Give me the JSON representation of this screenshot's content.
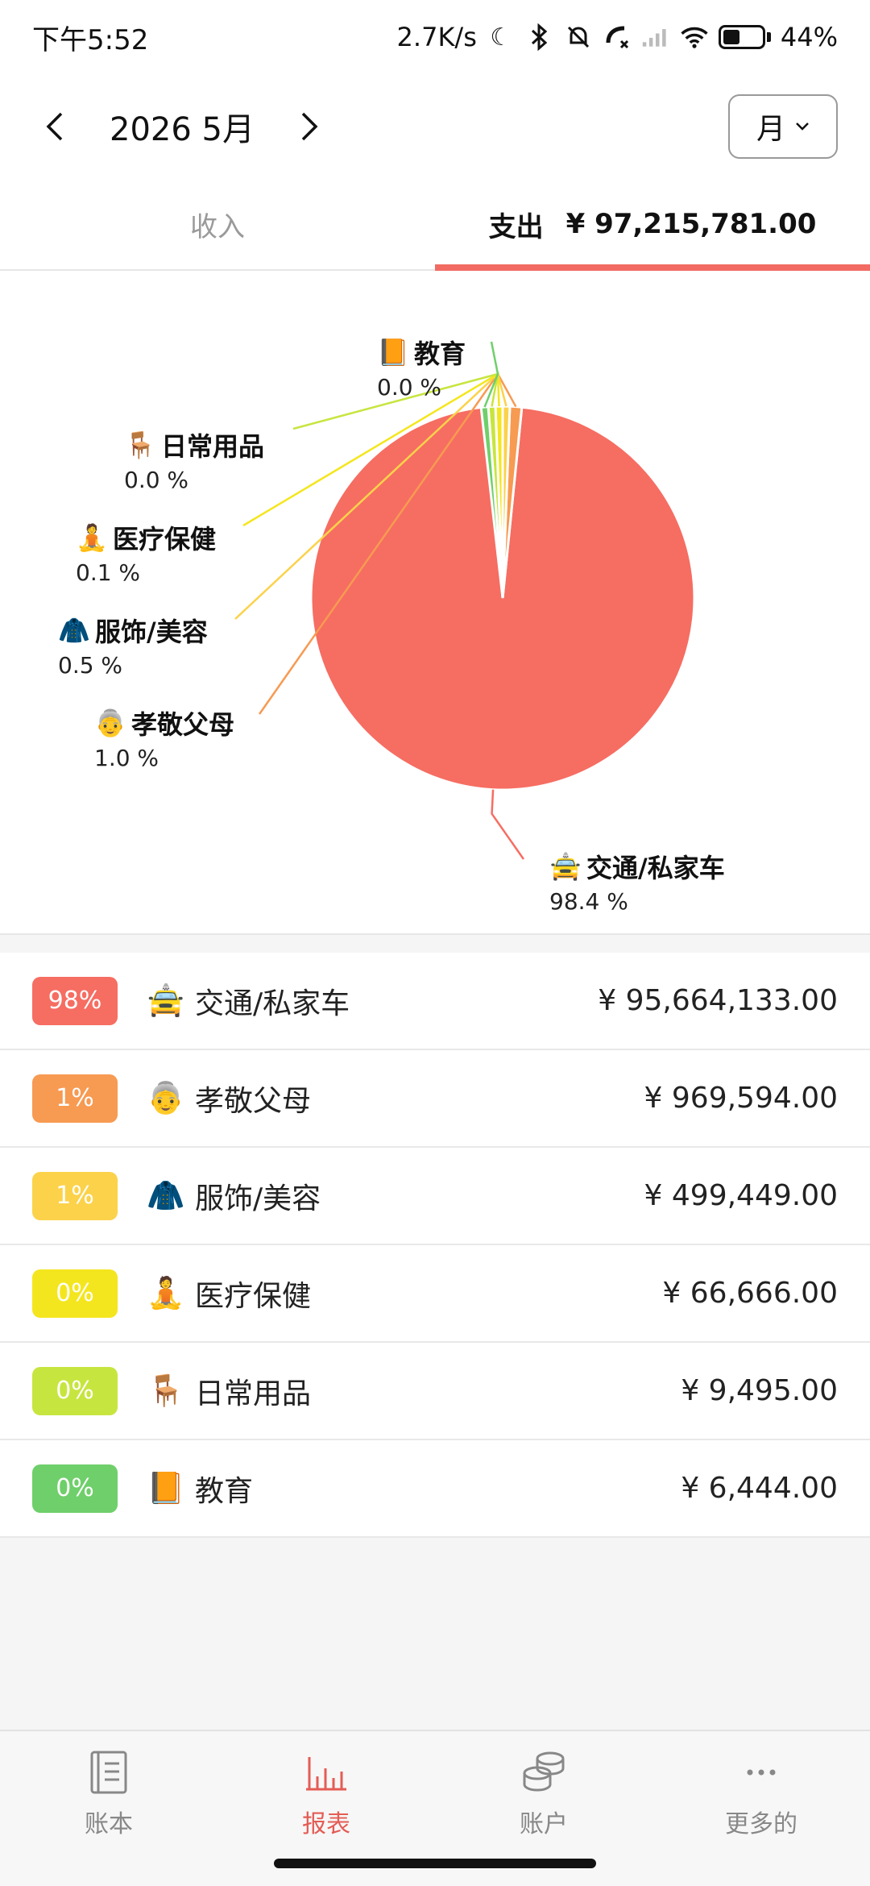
{
  "status": {
    "time": "下午5:52",
    "net_speed": "2.7K/s",
    "battery": "44%"
  },
  "header": {
    "date": "2026 5月",
    "period": "月"
  },
  "tabs": {
    "income_label": "收入",
    "expense_label": "支出",
    "expense_total": "¥ 97,215,781.00"
  },
  "chart_data": {
    "type": "pie",
    "slices": [
      {
        "name": "交通/私家车",
        "percent_label": "98.4 %",
        "value": 95664133.0,
        "color": "#f66d62"
      },
      {
        "name": "孝敬父母",
        "percent_label": "1.0 %",
        "value": 969594.0,
        "color": "#f79a52"
      },
      {
        "name": "服饰/美容",
        "percent_label": "0.5 %",
        "value": 499449.0,
        "color": "#fbd24a"
      },
      {
        "name": "医疗保健",
        "percent_label": "0.1 %",
        "value": 66666.0,
        "color": "#f4e61e"
      },
      {
        "name": "日常用品",
        "percent_label": "0.0 %",
        "value": 9495.0,
        "color": "#c7e53f"
      },
      {
        "name": "教育",
        "percent_label": "0.0 %",
        "value": 6444.0,
        "color": "#6fcf6a"
      }
    ]
  },
  "list": [
    {
      "badge": "98%",
      "icon": "taxi-icon",
      "glyph": "🚖",
      "name": "交通/私家车",
      "amount": "¥  95,664,133.00",
      "color": "#f66d62"
    },
    {
      "badge": "1%",
      "icon": "elder-icon",
      "glyph": "👵",
      "name": "孝敬父母",
      "amount": "¥  969,594.00",
      "color": "#f79a52"
    },
    {
      "badge": "1%",
      "icon": "coat-icon",
      "glyph": "🧥",
      "name": "服饰/美容",
      "amount": "¥  499,449.00",
      "color": "#fbd24a"
    },
    {
      "badge": "0%",
      "icon": "yoga-icon",
      "glyph": "🧘",
      "name": "医疗保健",
      "amount": "¥  66,666.00",
      "color": "#f4e61e"
    },
    {
      "badge": "0%",
      "icon": "chair-icon",
      "glyph": "🪑",
      "name": "日常用品",
      "amount": "¥  9,495.00",
      "color": "#c7e53f"
    },
    {
      "badge": "0%",
      "icon": "book-icon",
      "glyph": "📙",
      "name": "教育",
      "amount": "¥  6,444.00",
      "color": "#6fcf6a"
    }
  ],
  "nav": [
    {
      "label": "账本",
      "icon": "ledger-icon"
    },
    {
      "label": "报表",
      "icon": "chart-icon",
      "active": true
    },
    {
      "label": "账户",
      "icon": "coins-icon"
    },
    {
      "label": "更多的",
      "icon": "more-icon"
    }
  ],
  "colors": {
    "accent": "#f26b63"
  }
}
